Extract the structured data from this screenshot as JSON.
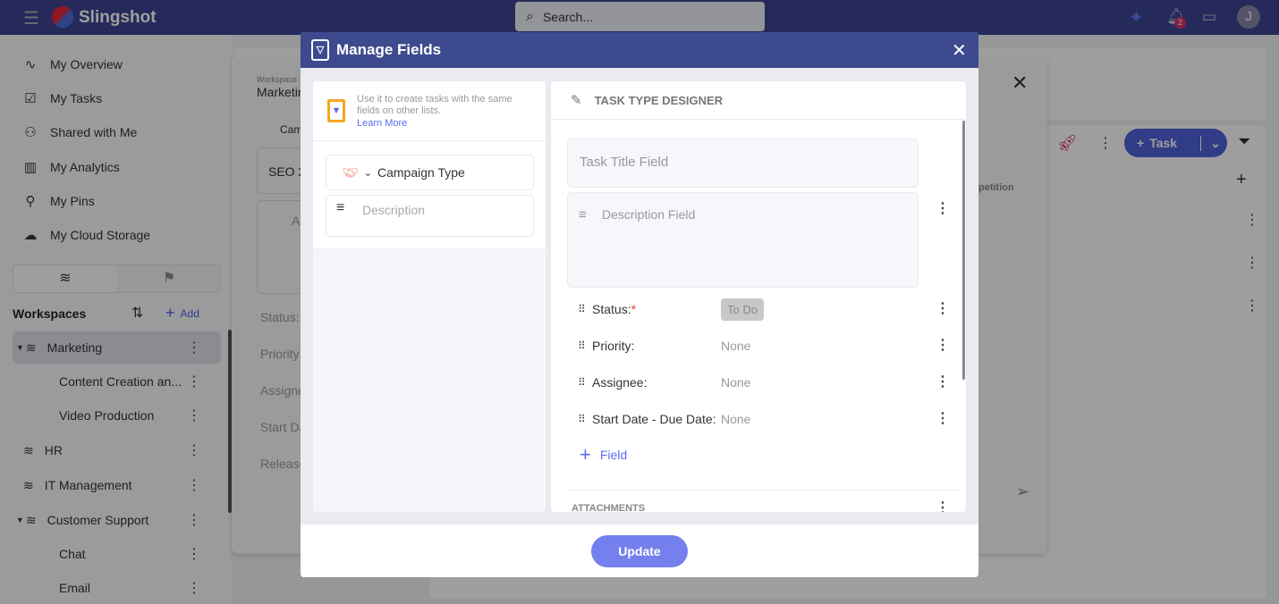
{
  "app": {
    "name": "Slingshot",
    "search_placeholder": "Search...",
    "notification_count": "2",
    "avatar_initial": "J"
  },
  "sidebar": {
    "nav": [
      {
        "label": "My Overview",
        "icon": "activity-icon"
      },
      {
        "label": "My Tasks",
        "icon": "clipboard-check-icon"
      },
      {
        "label": "Shared with Me",
        "icon": "user-share-icon"
      },
      {
        "label": "My Analytics",
        "icon": "bar-chart-icon"
      },
      {
        "label": "My Pins",
        "icon": "pin-icon"
      },
      {
        "label": "My Cloud Storage",
        "icon": "cloud-icon"
      }
    ],
    "workspaces_title": "Workspaces",
    "add_label": "Add",
    "workspaces": [
      {
        "label": "Marketing",
        "level": 0,
        "expanded": true,
        "selected": true
      },
      {
        "label": "Content Creation an...",
        "level": 1
      },
      {
        "label": "Video Production",
        "level": 1
      },
      {
        "label": "HR",
        "level": 0
      },
      {
        "label": "IT Management",
        "level": 0
      },
      {
        "label": "Customer Support",
        "level": 0,
        "expanded": true
      },
      {
        "label": "Chat",
        "level": 1
      },
      {
        "label": "Email",
        "level": 1
      }
    ]
  },
  "background": {
    "workspace_label": "Workspace",
    "workspace_name": "Marketing",
    "campaign": "Cam",
    "title": "SEO 2",
    "desc": "Ac",
    "fields": [
      "Status:",
      "Priority:",
      "Assignee:",
      "Start Da",
      "Release"
    ],
    "task_button": "Task",
    "column": "petition"
  },
  "modal": {
    "title": "Manage Fields",
    "info_text": "Use it to create tasks with the same fields on other lists.",
    "learn_more": "Learn More",
    "task_type": "Campaign Type",
    "description_placeholder": "Description",
    "designer_title": "TASK TYPE DESIGNER",
    "task_title_placeholder": "Task Title Field",
    "description_field_placeholder": "Description Field",
    "fields": [
      {
        "label": "Status:",
        "required": true,
        "value": "To Do"
      },
      {
        "label": "Priority:",
        "value": "None"
      },
      {
        "label": "Assignee:",
        "value": "None"
      },
      {
        "label": "Start Date - Due Date:",
        "value": "None"
      }
    ],
    "add_field": "Field",
    "attachments": "ATTACHMENTS",
    "update_button": "Update"
  },
  "colors": {
    "accent": "#7480ee",
    "header": "#3e4a8e",
    "link": "#5b6cf0",
    "required": "#e53935"
  }
}
